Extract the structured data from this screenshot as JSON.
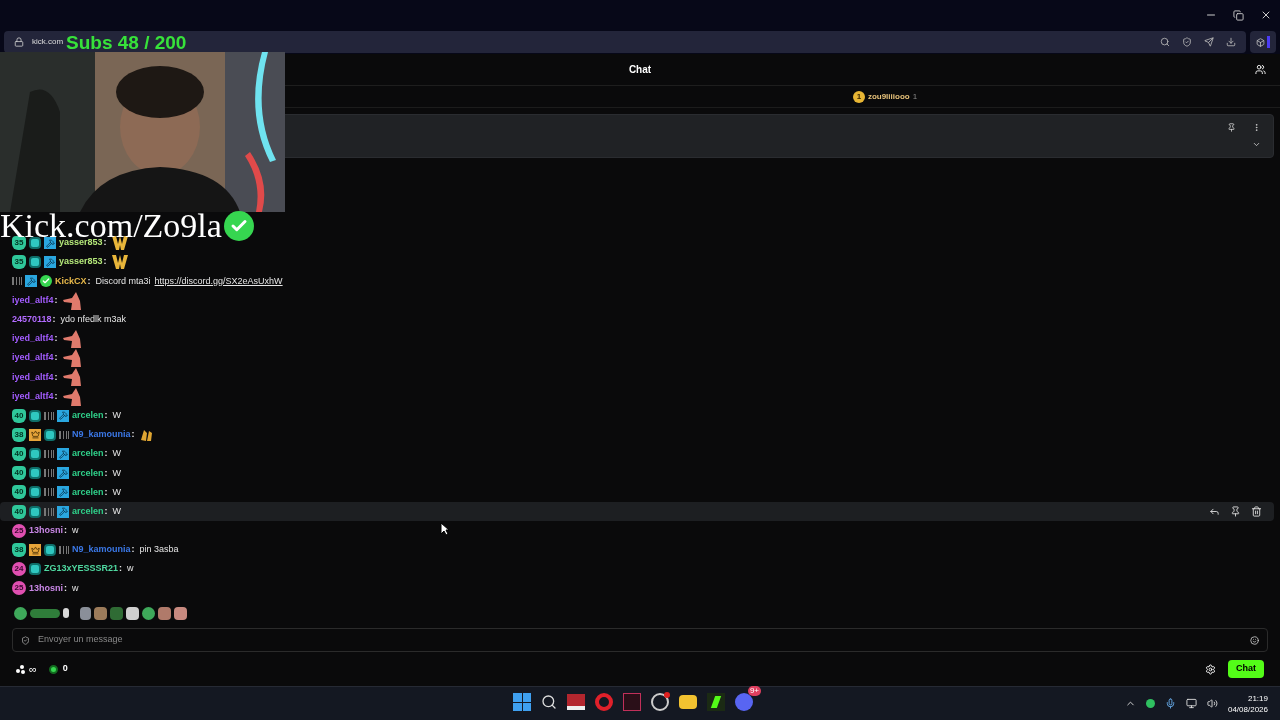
{
  "browser": {
    "url": "kick.com"
  },
  "overlay": {
    "subs": "Subs 48 / 200",
    "channel": "Kick.com/Zo9la"
  },
  "chat": {
    "title": "Chat",
    "leaderboard": [
      {
        "rank": "1",
        "name": "zou9liiiooo",
        "count": "1"
      }
    ],
    "messages": [
      {
        "badges": [
          {
            "kind": "sub",
            "label": "35"
          },
          {
            "kind": "og"
          },
          {
            "kind": "mod"
          }
        ],
        "user": "yasser853",
        "color": "#b5e97a",
        "highlighted": false,
        "parts": [
          {
            "kind": "w"
          }
        ]
      },
      {
        "badges": [
          {
            "kind": "sub",
            "label": "35"
          },
          {
            "kind": "og"
          },
          {
            "kind": "mod"
          }
        ],
        "user": "yasser853",
        "color": "#b5e97a",
        "highlighted": false,
        "parts": [
          {
            "kind": "w"
          }
        ]
      },
      {
        "badges": [
          {
            "kind": "zbl"
          },
          {
            "kind": "mod"
          },
          {
            "kind": "verified"
          }
        ],
        "user": "KickCX",
        "color": "#e8b94a",
        "highlighted": false,
        "parts": [
          {
            "kind": "text",
            "text": "Discord mta3i"
          },
          {
            "kind": "link",
            "text": "https://discord.gg/SX2eAsUxhW"
          }
        ]
      },
      {
        "user": "iyed_altf4",
        "color": "#a35cff",
        "highlighted": false,
        "parts": [
          {
            "kind": "patrick"
          }
        ]
      },
      {
        "user": "24570118",
        "color": "#b26bff",
        "highlighted": false,
        "parts": [
          {
            "kind": "text",
            "text": "ydo nfedlk m3ak"
          }
        ]
      },
      {
        "user": "iyed_altf4",
        "color": "#a35cff",
        "highlighted": false,
        "parts": [
          {
            "kind": "patrick"
          }
        ]
      },
      {
        "user": "iyed_altf4",
        "color": "#a35cff",
        "highlighted": false,
        "parts": [
          {
            "kind": "patrick"
          }
        ]
      },
      {
        "user": "iyed_altf4",
        "color": "#a35cff",
        "highlighted": false,
        "parts": [
          {
            "kind": "patrick"
          }
        ]
      },
      {
        "user": "iyed_altf4",
        "color": "#a35cff",
        "highlighted": false,
        "parts": [
          {
            "kind": "patrick"
          }
        ]
      },
      {
        "badges": [
          {
            "kind": "sub",
            "label": "40"
          },
          {
            "kind": "og"
          },
          {
            "kind": "zbl"
          },
          {
            "kind": "mod"
          }
        ],
        "user": "arcelen",
        "color": "#2fd08a",
        "highlighted": false,
        "parts": [
          {
            "kind": "text",
            "text": "W"
          }
        ]
      },
      {
        "badges": [
          {
            "kind": "sub",
            "label": "38"
          },
          {
            "kind": "crown"
          },
          {
            "kind": "og"
          },
          {
            "kind": "zbl"
          }
        ],
        "user": "N9_kamounia",
        "color": "#3b78e7",
        "highlighted": false,
        "parts": [
          {
            "kind": "clap"
          }
        ]
      },
      {
        "badges": [
          {
            "kind": "sub",
            "label": "40"
          },
          {
            "kind": "og"
          },
          {
            "kind": "zbl"
          },
          {
            "kind": "mod"
          }
        ],
        "user": "arcelen",
        "color": "#2fd08a",
        "highlighted": false,
        "parts": [
          {
            "kind": "text",
            "text": "W"
          }
        ]
      },
      {
        "badges": [
          {
            "kind": "sub",
            "label": "40"
          },
          {
            "kind": "og"
          },
          {
            "kind": "zbl"
          },
          {
            "kind": "mod"
          }
        ],
        "user": "arcelen",
        "color": "#2fd08a",
        "highlighted": false,
        "parts": [
          {
            "kind": "text",
            "text": "W"
          }
        ]
      },
      {
        "badges": [
          {
            "kind": "sub",
            "label": "40"
          },
          {
            "kind": "og"
          },
          {
            "kind": "zbl"
          },
          {
            "kind": "mod"
          }
        ],
        "user": "arcelen",
        "color": "#2fd08a",
        "highlighted": false,
        "parts": [
          {
            "kind": "text",
            "text": "W"
          }
        ]
      },
      {
        "badges": [
          {
            "kind": "sub",
            "label": "40"
          },
          {
            "kind": "og"
          },
          {
            "kind": "zbl"
          },
          {
            "kind": "mod"
          }
        ],
        "user": "arcelen",
        "color": "#2fd08a",
        "highlighted": true,
        "parts": [
          {
            "kind": "text",
            "text": "W"
          }
        ]
      },
      {
        "badges": [
          {
            "kind": "pink",
            "label": "25"
          }
        ],
        "user": "13hosni",
        "color": "#c987e6",
        "highlighted": false,
        "parts": [
          {
            "kind": "text",
            "text": "w"
          }
        ]
      },
      {
        "badges": [
          {
            "kind": "sub",
            "label": "38"
          },
          {
            "kind": "crown"
          },
          {
            "kind": "og"
          },
          {
            "kind": "zbl"
          }
        ],
        "user": "N9_kamounia",
        "color": "#3b78e7",
        "highlighted": false,
        "parts": [
          {
            "kind": "text",
            "text": "pin 3asba"
          }
        ]
      },
      {
        "badges": [
          {
            "kind": "pink",
            "label": "24"
          },
          {
            "kind": "og"
          }
        ],
        "user": "ZG13xYESSSR21",
        "color": "#4fd8a0",
        "highlighted": false,
        "parts": [
          {
            "kind": "text",
            "text": "w"
          }
        ]
      },
      {
        "badges": [
          {
            "kind": "pink",
            "label": "25"
          }
        ],
        "user": "13hosni",
        "color": "#c987e6",
        "highlighted": false,
        "parts": [
          {
            "kind": "text",
            "text": "w"
          }
        ]
      }
    ],
    "separator": ":",
    "input": {
      "placeholder": "Envoyer un message"
    },
    "points": "∞",
    "count": "0",
    "send": "Chat"
  },
  "taskbar": {
    "discord_badge": "9+",
    "time": "21:19",
    "date": "04/08/2026"
  }
}
